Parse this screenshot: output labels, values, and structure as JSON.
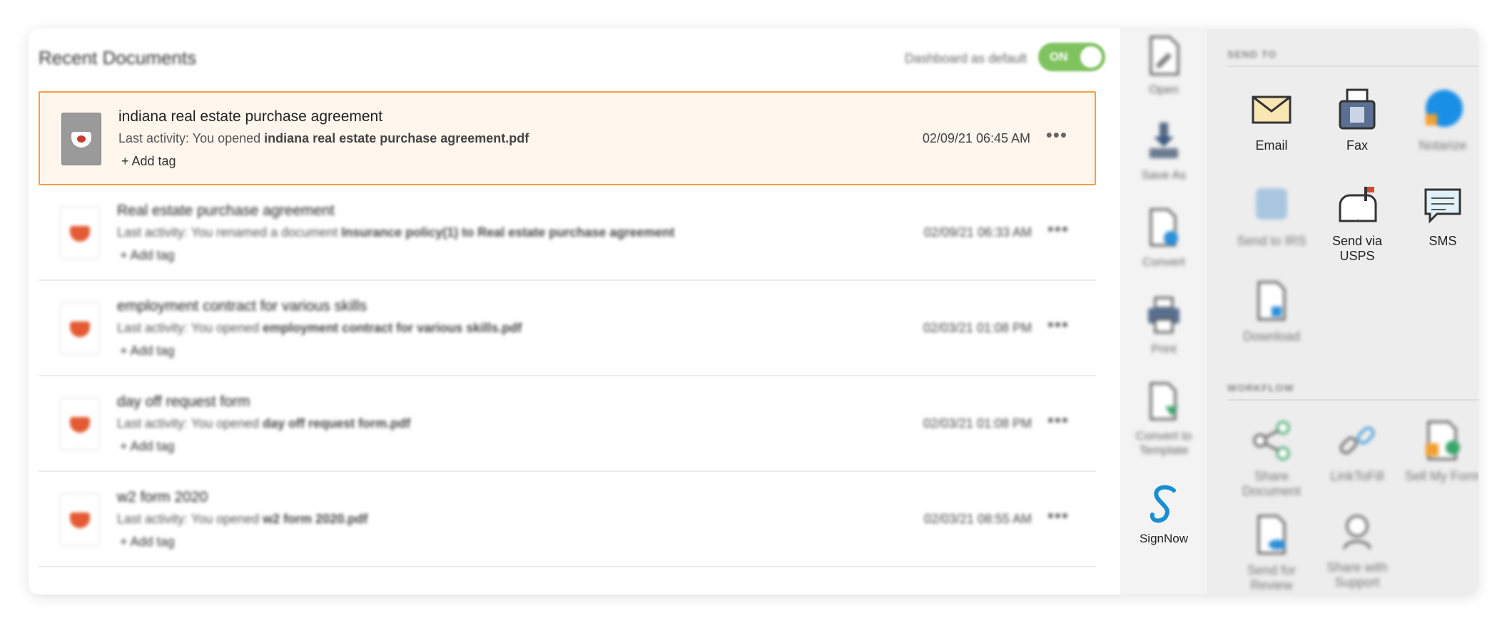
{
  "header": {
    "title": "Recent Documents",
    "toggle_label": "Dashboard as default",
    "toggle_state": "ON"
  },
  "documents": [
    {
      "title": "indiana real estate purchase agreement",
      "activity_prefix": "Last activity: You opened ",
      "activity_target": "indiana real estate purchase agreement.pdf",
      "add_tag": "+ Add tag",
      "date": "02/09/21 06:45 AM",
      "more": "•••"
    },
    {
      "title": "Real estate purchase agreement",
      "activity_prefix": "Last activity: You renamed a document ",
      "activity_target": "Insurance policy(1) to Real estate purchase agreement",
      "add_tag": "+ Add tag",
      "date": "02/09/21 06:33 AM",
      "more": "•••"
    },
    {
      "title": "employment contract for various skills",
      "activity_prefix": "Last activity: You opened ",
      "activity_target": "employment contract for various skills.pdf",
      "add_tag": "+ Add tag",
      "date": "02/03/21 01:08 PM",
      "more": "•••"
    },
    {
      "title": "day off request form",
      "activity_prefix": "Last activity: You opened ",
      "activity_target": "day off request form.pdf",
      "add_tag": "+ Add tag",
      "date": "02/03/21 01:08 PM",
      "more": "•••"
    },
    {
      "title": "w2 form 2020",
      "activity_prefix": "Last activity: You opened ",
      "activity_target": "w2 form 2020.pdf",
      "add_tag": "+ Add tag",
      "date": "02/03/21 08:55 AM",
      "more": "•••"
    }
  ],
  "tools": [
    {
      "label": "Open",
      "icon": "open-doc-icon"
    },
    {
      "label": "Save As",
      "icon": "save-as-icon"
    },
    {
      "label": "Convert",
      "icon": "convert-icon"
    },
    {
      "label": "Print",
      "icon": "printer-icon"
    },
    {
      "label": "Convert to Template",
      "icon": "template-icon"
    },
    {
      "label": "SignNow",
      "icon": "signnow-icon"
    }
  ],
  "send_to": {
    "label": "SEND TO",
    "items": [
      {
        "label": "Email",
        "icon": "envelope-icon"
      },
      {
        "label": "Fax",
        "icon": "fax-icon"
      },
      {
        "label": "Notarize",
        "icon": "notarize-icon"
      },
      {
        "label": "Send to IRS",
        "icon": "irs-icon"
      },
      {
        "label": "Send via USPS",
        "icon": "mailbox-icon"
      },
      {
        "label": "SMS",
        "icon": "sms-icon"
      },
      {
        "label": "Download",
        "icon": "download-icon"
      }
    ]
  },
  "workflow": {
    "label": "WORKFLOW",
    "items": [
      {
        "label": "Share Document",
        "icon": "share-icon"
      },
      {
        "label": "LinkToFill",
        "icon": "link-icon"
      },
      {
        "label": "Sell My Form",
        "icon": "sell-form-icon"
      },
      {
        "label": "Send for Review",
        "icon": "review-icon"
      },
      {
        "label": "Share with Support",
        "icon": "support-icon"
      }
    ]
  },
  "colors": {
    "selection_border": "#f5a043",
    "selection_bg": "#fff6ee",
    "toggle_on": "#7fc35f",
    "brand_red": "#e35a34",
    "signnow_blue": "#1a8fd0"
  }
}
